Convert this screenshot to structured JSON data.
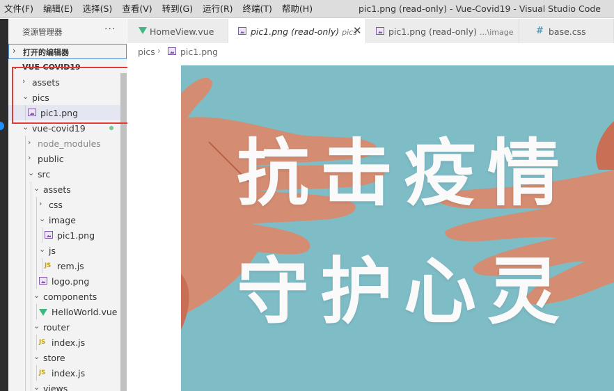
{
  "menu": [
    "文件(F)",
    "编辑(E)",
    "选择(S)",
    "查看(V)",
    "转到(G)",
    "运行(R)",
    "终端(T)",
    "帮助(H)"
  ],
  "window_title": "pic1.png (read-only) - Vue-Covid19 - Visual Studio Code",
  "sidebar": {
    "title": "资源管理器",
    "more": "···",
    "open_editors": "打开的编辑器",
    "project": "VUE-COVID19"
  },
  "tree": [
    {
      "label": "assets",
      "indent": 0,
      "kind": "folder",
      "expanded": false
    },
    {
      "label": "pics",
      "indent": 0,
      "kind": "folder",
      "expanded": true
    },
    {
      "label": "pic1.png",
      "indent": 1,
      "kind": "image",
      "selected": true
    },
    {
      "label": "vue-covid19",
      "indent": 0,
      "kind": "folder",
      "expanded": true,
      "modified": true
    },
    {
      "label": "node_modules",
      "indent": 1,
      "kind": "folder",
      "expanded": false,
      "dim": true
    },
    {
      "label": "public",
      "indent": 1,
      "kind": "folder",
      "expanded": false
    },
    {
      "label": "src",
      "indent": 1,
      "kind": "folder",
      "expanded": true
    },
    {
      "label": "assets",
      "indent": 2,
      "kind": "folder",
      "expanded": true
    },
    {
      "label": "css",
      "indent": 3,
      "kind": "folder",
      "expanded": false
    },
    {
      "label": "image",
      "indent": 3,
      "kind": "folder",
      "expanded": true
    },
    {
      "label": "pic1.png",
      "indent": 4,
      "kind": "image"
    },
    {
      "label": "js",
      "indent": 3,
      "kind": "folder",
      "expanded": true
    },
    {
      "label": "rem.js",
      "indent": 4,
      "kind": "js"
    },
    {
      "label": "logo.png",
      "indent": 3,
      "kind": "image"
    },
    {
      "label": "components",
      "indent": 2,
      "kind": "folder",
      "expanded": true
    },
    {
      "label": "HelloWorld.vue",
      "indent": 3,
      "kind": "vue"
    },
    {
      "label": "router",
      "indent": 2,
      "kind": "folder",
      "expanded": true
    },
    {
      "label": "index.js",
      "indent": 3,
      "kind": "js"
    },
    {
      "label": "store",
      "indent": 2,
      "kind": "folder",
      "expanded": true
    },
    {
      "label": "index.js",
      "indent": 3,
      "kind": "js"
    },
    {
      "label": "views",
      "indent": 2,
      "kind": "folder",
      "expanded": true
    }
  ],
  "tabs": [
    {
      "label": "HomeView.vue",
      "icon": "vue"
    },
    {
      "label": "pic1.png (read-only)",
      "desc": "pics",
      "icon": "image",
      "active": true,
      "close": "✕"
    },
    {
      "label": "pic1.png (read-only)",
      "desc": "...\\image",
      "icon": "image"
    },
    {
      "label": "base.css",
      "icon": "hash"
    }
  ],
  "breadcrumb": {
    "folder": "pics",
    "file": "pic1.png",
    "separator": "›"
  },
  "poster": {
    "line1": "抗击疫情",
    "line2": "守护心灵"
  },
  "colors": {
    "accent": "#4d90d5",
    "highlight_box": "#e53935",
    "preview_bg": "#7ebcc6",
    "vue": "#41b883",
    "js": "#c4a000",
    "modified": "#73c991"
  },
  "icons": {
    "folder_collapsed": "›",
    "folder_expanded": "⌄",
    "chevron_collapsed": "›"
  }
}
